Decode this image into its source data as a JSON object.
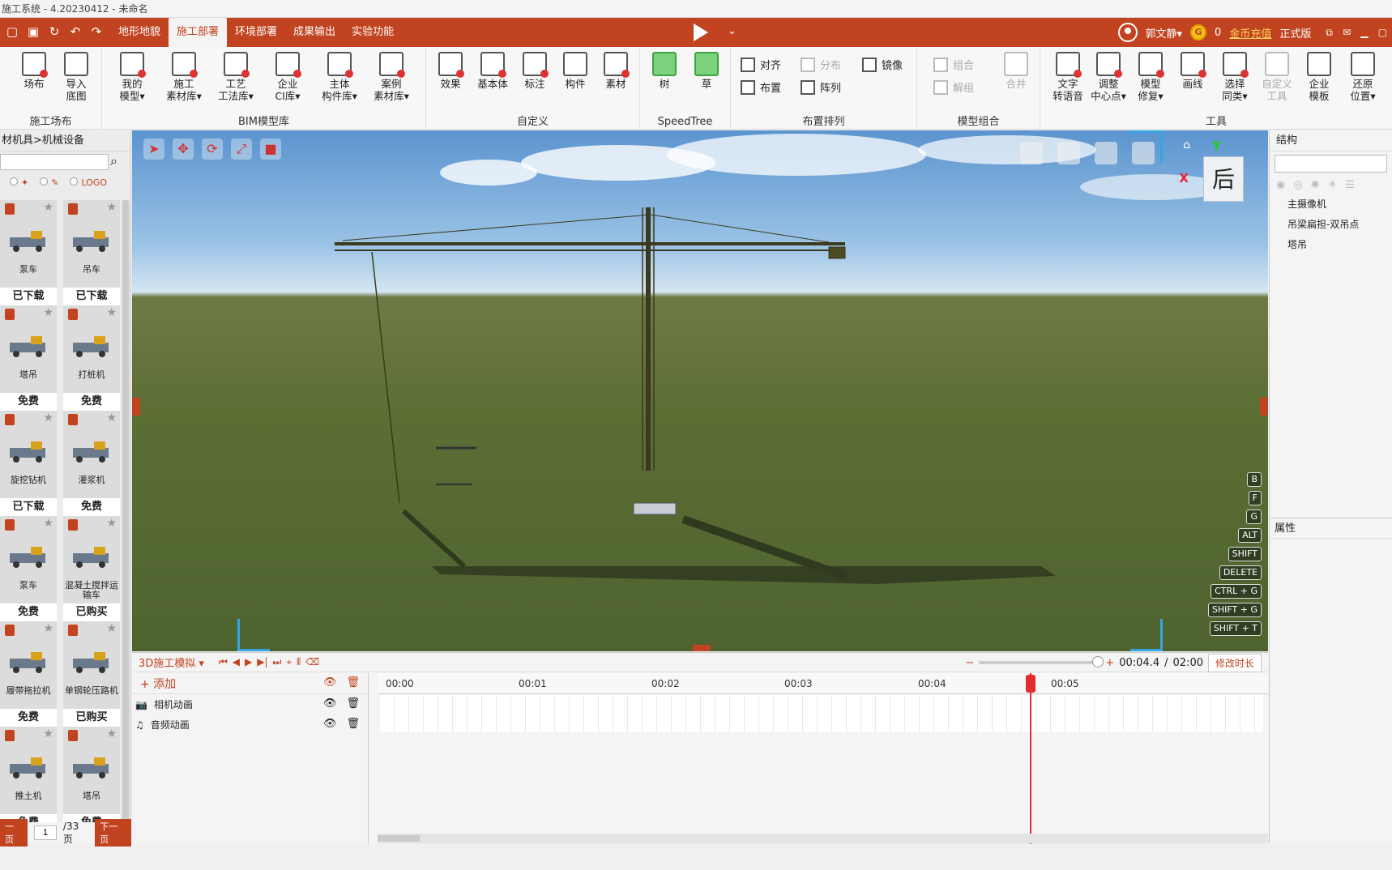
{
  "window": {
    "title": "施工系统 - 4.20230412 - 未命名"
  },
  "menubar": {
    "tabs": [
      "地形地貌",
      "施工部署",
      "环境部署",
      "成果输出",
      "实验功能"
    ],
    "active_tab": "施工部署",
    "user_name": "郭文静▾",
    "coins": "0",
    "coin_icon_text": "G",
    "recharge": "金币充值",
    "edition": "正式版"
  },
  "ribbon": {
    "groups": [
      {
        "label": "施工场布",
        "buttons": [
          "场布",
          "导入\n底图"
        ]
      },
      {
        "label": "BIM模型库",
        "buttons": [
          "我的\n模型▾",
          "施工\n素材库▾",
          "工艺\n工法库▾",
          "企业\nCI库▾",
          "主体\n构件库▾",
          "案例\n素材库▾"
        ]
      },
      {
        "label": "自定义",
        "buttons": [
          "效果",
          "基本体",
          "标注",
          "构件",
          "素材"
        ]
      },
      {
        "label": "SpeedTree",
        "buttons": [
          "树",
          "草"
        ]
      },
      {
        "label": "布置排列",
        "small": [
          "对齐",
          "分布",
          "镜像",
          "布置",
          "阵列"
        ]
      },
      {
        "label": "模型组合",
        "small": [
          "组合",
          "解组",
          "合并"
        ]
      },
      {
        "label": "工具",
        "buttons": [
          "文字\n转语音",
          "调整\n中心点▾",
          "模型\n修复▾",
          "画线",
          "选择\n同类▾",
          "自定义\n工具",
          "企业\n模板",
          "还原\n位置▾"
        ]
      }
    ]
  },
  "left": {
    "breadcrumb": "材机具>机械设备",
    "search_placeholder": "",
    "filters": [
      "",
      "",
      "LOGO"
    ],
    "cards": [
      {
        "name": "泵车",
        "status": "已下载"
      },
      {
        "name": "吊车",
        "status": "已下载"
      },
      {
        "name": "塔吊",
        "status": "免费"
      },
      {
        "name": "打桩机",
        "status": "免费"
      },
      {
        "name": "旋挖钻机",
        "status": "已下载"
      },
      {
        "name": "灌浆机",
        "status": "免费"
      },
      {
        "name": "泵车",
        "status": "免费"
      },
      {
        "name": "混凝土搅拌运输车",
        "status": "已购买"
      },
      {
        "name": "履带拖拉机",
        "status": "免费"
      },
      {
        "name": "单钢轮压路机",
        "status": "已购买"
      },
      {
        "name": "推土机",
        "status": "免费"
      },
      {
        "name": "塔吊",
        "status": "免费"
      }
    ],
    "pager": {
      "prev": "一页",
      "page": "1",
      "total": "/33页",
      "next": "下一页"
    }
  },
  "viewport": {
    "cube_face": "后",
    "axis_x": "X",
    "axis_y": "Y",
    "shortcuts": [
      "B",
      "F",
      "G",
      "ALT",
      "SHIFT",
      "DELETE",
      "CTRL + G",
      "SHIFT + G",
      "SHIFT + T"
    ]
  },
  "right": {
    "structure_title": "结构",
    "items": [
      "主摄像机",
      "吊梁扁担-双吊点",
      "塔吊"
    ],
    "properties_title": "属性"
  },
  "timeline": {
    "mode": "3D施工模拟 ▾",
    "current_time": "00:04.4",
    "separator": "/",
    "total_time": "02:00",
    "modify_btn": "修改时长",
    "add_label": "+ 添加",
    "tracks": [
      "相机动画",
      "音频动画"
    ],
    "ticks": [
      "00:00",
      "00:01",
      "00:02",
      "00:03",
      "00:04",
      "00:05"
    ]
  },
  "colors": {
    "accent": "#c1431f",
    "playhead": "#e12d2d",
    "sky": "#8ebbe3",
    "grass": "#566a33"
  }
}
